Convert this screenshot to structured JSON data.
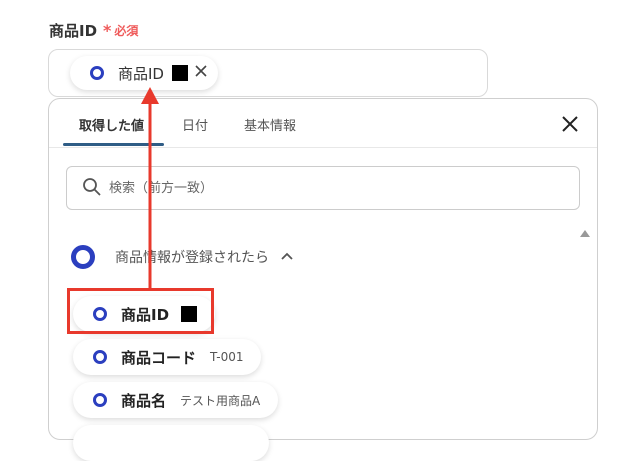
{
  "field": {
    "label": "商品ID",
    "required_mark": "*",
    "required_text": "必須"
  },
  "selected_chip": {
    "label": "商品ID",
    "remove_icon": "close-icon"
  },
  "panel": {
    "tabs": [
      {
        "label": "取得した値",
        "active": true
      },
      {
        "label": "日付",
        "active": false
      },
      {
        "label": "基本情報",
        "active": false
      }
    ],
    "close_icon": "close-icon",
    "search": {
      "placeholder": "検索（前方一致）",
      "value": ""
    },
    "group": {
      "title": "商品情報が登録されたら",
      "expanded": true
    },
    "items": [
      {
        "label": "商品ID",
        "value": ""
      },
      {
        "label": "商品コード",
        "value": "T-001"
      },
      {
        "label": "商品名",
        "value": "テスト用商品A"
      }
    ]
  },
  "colors": {
    "accent_blue": "#2b3fbf",
    "required_red": "#ef5b5b",
    "annotation_red": "#e8392c",
    "tab_underline": "#2f5d86"
  }
}
